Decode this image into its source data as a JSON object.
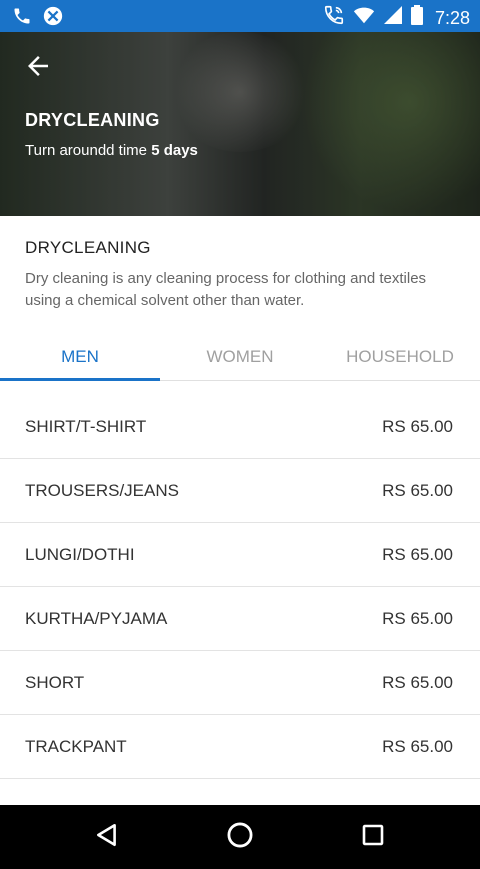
{
  "status_bar": {
    "time": "7:28",
    "icons": [
      "phone-icon",
      "no-sim-icon",
      "wifi-call-icon",
      "wifi-icon",
      "signal-icon",
      "battery-icon"
    ]
  },
  "hero": {
    "title": "DRYCLEANING",
    "turnaround_prefix": "Turn aroundd time",
    "turnaround_value": "5 days"
  },
  "service": {
    "title": "DRYCLEANING",
    "description": "Dry cleaning is any cleaning process for clothing and textiles using a chemical solvent other than water."
  },
  "tabs": [
    {
      "label": "MEN",
      "active": true
    },
    {
      "label": "WOMEN",
      "active": false
    },
    {
      "label": "HOUSEHOLD",
      "active": false
    }
  ],
  "items": [
    {
      "name": "SHIRT/T-SHIRT",
      "price": "RS 65.00"
    },
    {
      "name": "TROUSERS/JEANS",
      "price": "RS 65.00"
    },
    {
      "name": "LUNGI/DOTHI",
      "price": "RS 65.00"
    },
    {
      "name": "KURTHA/PYJAMA",
      "price": "RS 65.00"
    },
    {
      "name": "SHORT",
      "price": "RS 65.00"
    },
    {
      "name": "TRACKPANT",
      "price": "RS 65.00"
    }
  ],
  "colors": {
    "accent": "#1a73c8",
    "status_bar": "#1a73c8"
  }
}
